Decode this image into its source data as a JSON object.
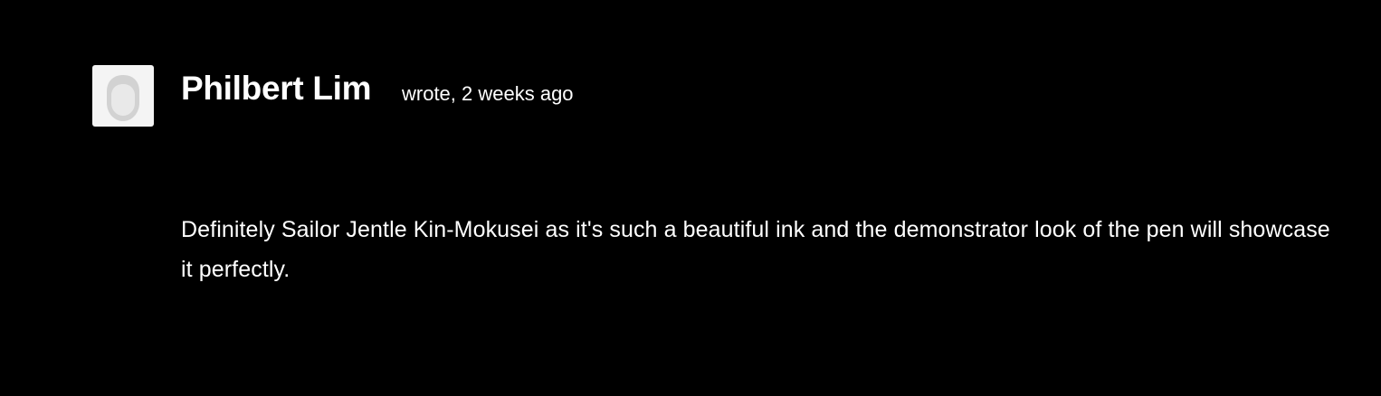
{
  "comment": {
    "author": "Philbert Lim",
    "meta": "wrote, 2 weeks ago",
    "text": "Definitely Sailor Jentle Kin-Mokusei as it's such a beautiful ink and the demonstrator look of the pen will showcase it perfectly.",
    "avatar_icon": "default-user-silhouette-icon"
  },
  "colors": {
    "background": "#000000",
    "text": "#ffffff",
    "avatar_background": "#f4f4f4",
    "avatar_icon": "#cccccc"
  }
}
